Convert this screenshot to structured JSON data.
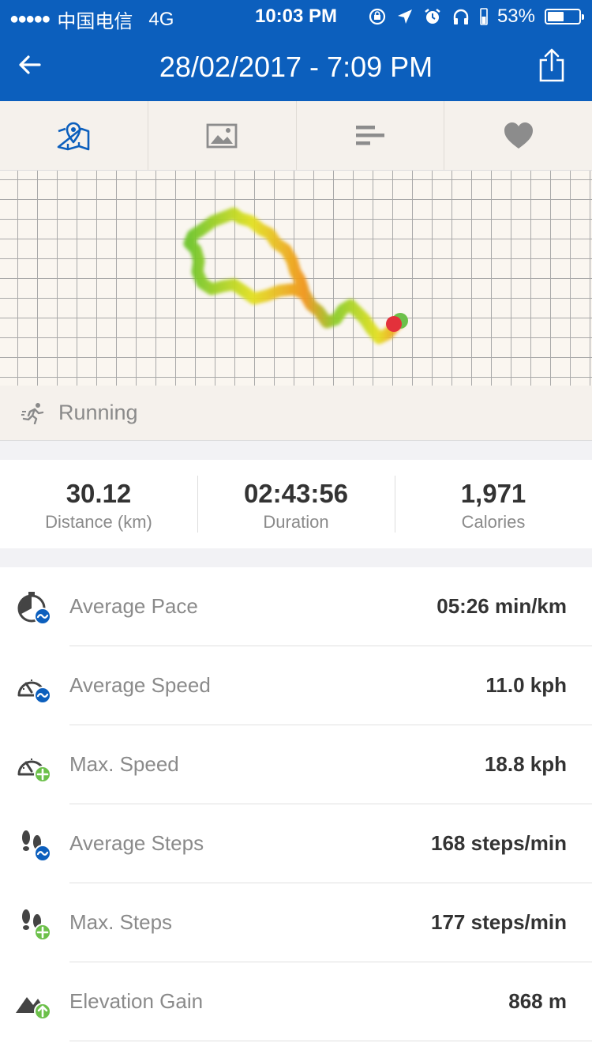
{
  "status_bar": {
    "signal": "●●●●●",
    "carrier": "中国电信",
    "network": "4G",
    "time": "10:03 PM",
    "battery_percent": "53%",
    "battery_level": 0.53
  },
  "header": {
    "title": "28/02/2017 - 7:09 PM",
    "back_icon": "back-arrow-icon",
    "share_icon": "share-icon"
  },
  "tabs": [
    {
      "icon": "map-icon",
      "active": true
    },
    {
      "icon": "photo-icon",
      "active": false
    },
    {
      "icon": "splits-icon",
      "active": false
    },
    {
      "icon": "heart-icon",
      "active": false
    }
  ],
  "activity": {
    "type": "Running",
    "icon": "running-icon"
  },
  "summary": [
    {
      "value": "30.12",
      "label": "Distance (km)"
    },
    {
      "value": "02:43:56",
      "label": "Duration"
    },
    {
      "value": "1,971",
      "label": "Calories"
    }
  ],
  "stats": [
    {
      "label": "Average Pace",
      "value": "05:26 min/km",
      "icon": "stopwatch-average-icon"
    },
    {
      "label": "Average Speed",
      "value": "11.0 kph",
      "icon": "speedometer-average-icon"
    },
    {
      "label": "Max. Speed",
      "value": "18.8 kph",
      "icon": "speedometer-max-icon"
    },
    {
      "label": "Average Steps",
      "value": "168 steps/min",
      "icon": "footsteps-average-icon"
    },
    {
      "label": "Max. Steps",
      "value": "177 steps/min",
      "icon": "footsteps-max-icon"
    },
    {
      "label": "Elevation Gain",
      "value": "868 m",
      "icon": "mountain-up-icon"
    }
  ],
  "colors": {
    "brand_blue": "#0c5fbd",
    "average_badge": "#0c5fbd",
    "max_badge": "#6cc04a",
    "route_green": "#8ccd2a",
    "route_yellow": "#e3e022",
    "route_orange": "#f1951f",
    "end_marker": "#e3313b"
  }
}
